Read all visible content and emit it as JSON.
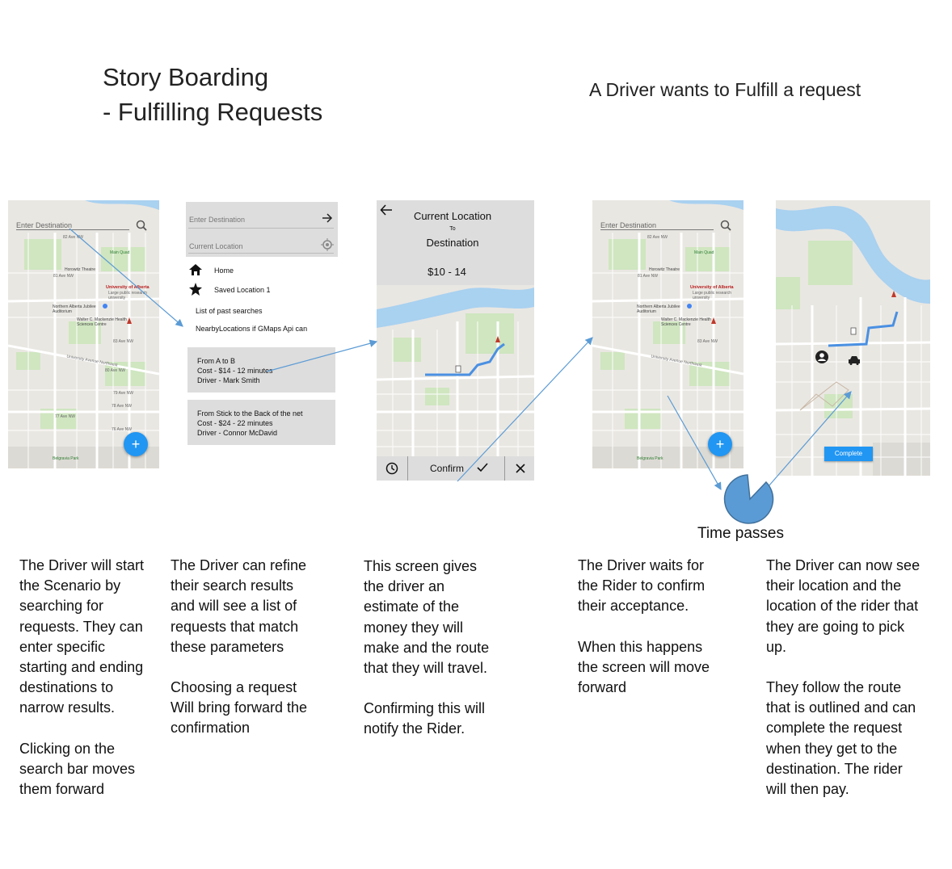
{
  "header": {
    "title_line1": "Story Boarding",
    "title_line2": "- Fulfilling Requests",
    "subtitle": "A Driver wants to Fulfill a request"
  },
  "screen1": {
    "search_placeholder": "Enter Destination",
    "fab_label": "+",
    "map_labels": [
      "82 Ave NW",
      "Main Quad",
      "Horowitz Theatre",
      "81 Ave NW",
      "University of Alberta",
      "Large public research university",
      "Northern Alberta Jubilee Auditorium",
      "Walter C. Mackenzie Health Sciences Centre",
      "83 Ave NW",
      "University Avenue Northwest",
      "80 Ave NW",
      "79 Ave NW",
      "78 Ave NW",
      "77 Ave NW",
      "76 Ave NW",
      "Belgravia Park"
    ]
  },
  "screen2": {
    "destination_placeholder": "Enter Destination",
    "current_location_placeholder": "Current Location",
    "home_label": "Home",
    "saved_label": "Saved Location 1",
    "past_searches": "List of past searches",
    "nearby": "NearbyLocations if GMaps Api can",
    "cards": [
      {
        "line1": "From A to B",
        "line2": "Cost - $14  - 12 minutes",
        "line3": "Driver - Mark Smith"
      },
      {
        "line1": "From Stick to the Back of the net",
        "line2": "Cost - $24  - 22 minutes",
        "line3": "Driver -  Connor McDavid"
      }
    ]
  },
  "screen3": {
    "current_location": "Current Location",
    "to": "To",
    "destination": "Destination",
    "price": "$10 - 14",
    "confirm_label": "Confirm"
  },
  "screen4": {
    "search_placeholder": "Enter Destination",
    "fab_label": "+"
  },
  "screen5": {
    "complete_label": "Complete"
  },
  "time_passes": "Time passes",
  "descriptions": {
    "col1": [
      "The Driver will start the Scenario by searching for requests. They can enter specific starting and ending destinations to narrow results.",
      "Clicking on the search bar moves them forward"
    ],
    "col2": [
      "The Driver can refine their search results and will see a list of requests that match these parameters",
      "Choosing a request Will bring forward the confirmation"
    ],
    "col3": [
      "This screen gives the driver an estimate of the money they will make and the route that they will travel.",
      "Confirming this will notify the Rider."
    ],
    "col4": [
      "The Driver waits for the Rider to confirm their acceptance.",
      "When this happens the screen will move forward"
    ],
    "col5": [
      "The Driver can now see their location and the location of the rider that they are going to pick up.",
      "They follow the route that is outlined and can complete the request when they get to the destination. The rider will then pay."
    ]
  },
  "colors": {
    "arrow": "#5b9bd5",
    "fab": "#2196f3",
    "route": "#4a90e2",
    "pie": "#5b9bd5",
    "complete_button": "#2196f3"
  }
}
